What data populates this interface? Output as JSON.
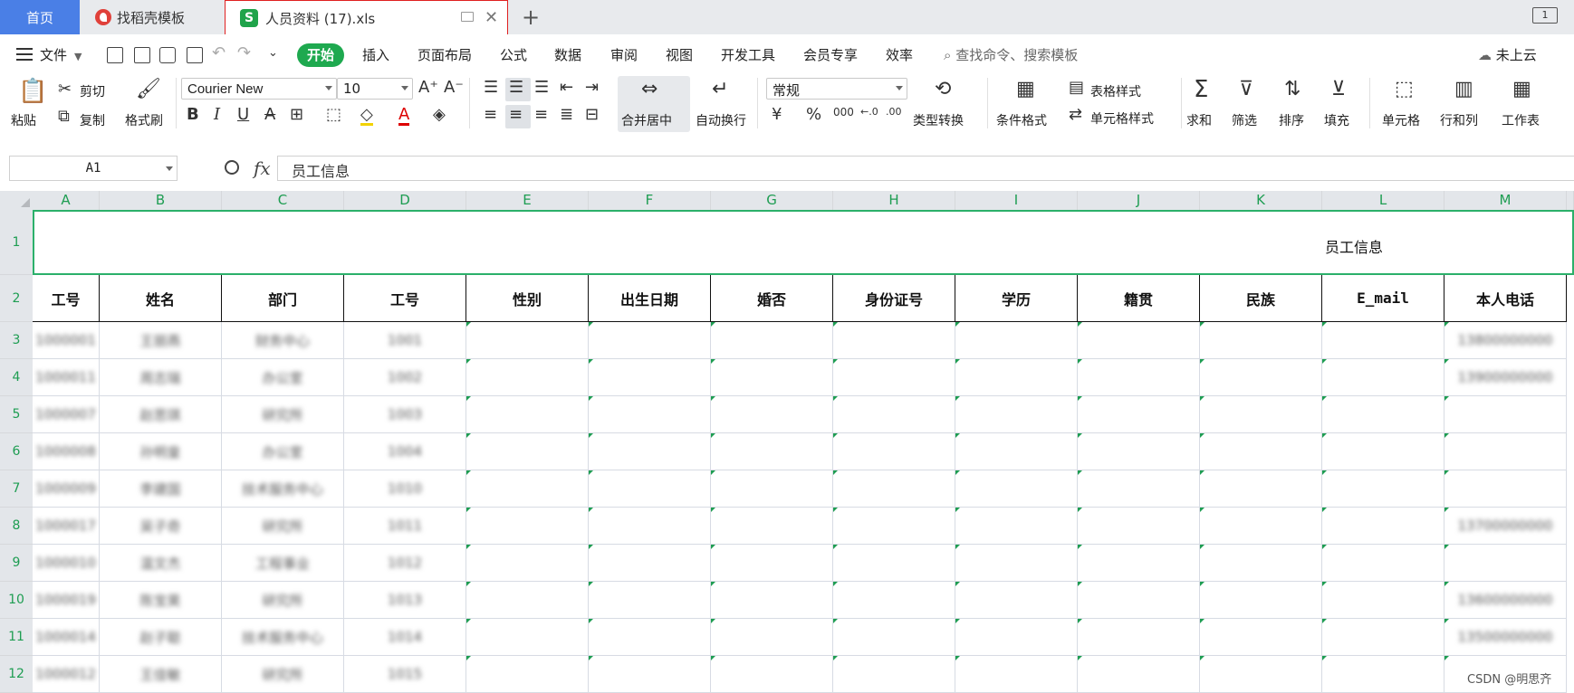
{
  "tabs": {
    "home": "首页",
    "template": "找稻壳模板",
    "file": "人员资料 (17).xls",
    "file_logo": "S",
    "add": "+",
    "win": "1"
  },
  "menu": {
    "file": "文件",
    "items": [
      "开始",
      "插入",
      "页面布局",
      "公式",
      "数据",
      "审阅",
      "视图",
      "开发工具",
      "会员专享",
      "效率"
    ],
    "search": "查找命令、搜索模板",
    "cloud": "未上云"
  },
  "ribbon": {
    "paste": "粘贴",
    "cut": "剪切",
    "copy": "复制",
    "format_painter": "格式刷",
    "font_name": "Courier New",
    "font_size": "10",
    "merge": "合并居中",
    "wrap": "自动换行",
    "number_format": "常规",
    "convert": "类型转换",
    "cond_format": "条件格式",
    "table_style": "表格样式",
    "cell_style": "单元格样式",
    "sum": "求和",
    "filter": "筛选",
    "sort": "排序",
    "fill": "填充",
    "cell": "单元格",
    "row_col": "行和列",
    "sheet": "工作表"
  },
  "formula_bar": {
    "name_box": "A1",
    "fx": "fx",
    "value": "员工信息"
  },
  "sheet": {
    "columns": [
      "A",
      "B",
      "C",
      "D",
      "E",
      "F",
      "G",
      "H",
      "I",
      "J",
      "K",
      "L",
      "M"
    ],
    "rows": [
      "1",
      "2",
      "3",
      "4",
      "5",
      "6",
      "7",
      "8",
      "9",
      "10",
      "11",
      "12"
    ],
    "title": "员工信息",
    "headers": [
      "工号",
      "姓名",
      "部门",
      "工号",
      "性别",
      "出生日期",
      "婚否",
      "身份证号",
      "学历",
      "籍贯",
      "民族",
      "E_mail",
      "本人电话"
    ],
    "data": [
      [
        "1000001",
        "王丽燕",
        "财务中心",
        "1001",
        "",
        "",
        "",
        "",
        "",
        "",
        "",
        "",
        "13800000000"
      ],
      [
        "1000011",
        "周志瑞",
        "办公室",
        "1002",
        "",
        "",
        "",
        "",
        "",
        "",
        "",
        "",
        "13900000000"
      ],
      [
        "1000007",
        "赵思琪",
        "研究所",
        "1003",
        "",
        "",
        "",
        "",
        "",
        "",
        "",
        "",
        ""
      ],
      [
        "1000008",
        "孙明皇",
        "办公室",
        "1004",
        "",
        "",
        "",
        "",
        "",
        "",
        "",
        "",
        ""
      ],
      [
        "1000009",
        "李建国",
        "技术服务中心",
        "1010",
        "",
        "",
        "",
        "",
        "",
        "",
        "",
        "",
        ""
      ],
      [
        "1000017",
        "吴子奇",
        "研究所",
        "1011",
        "",
        "",
        "",
        "",
        "",
        "",
        "",
        "",
        "13700000000"
      ],
      [
        "1000010",
        "温文杰",
        "工程事业",
        "1012",
        "",
        "",
        "",
        "",
        "",
        "",
        "",
        "",
        ""
      ],
      [
        "1000019",
        "陈宝昊",
        "研究所",
        "1013",
        "",
        "",
        "",
        "",
        "",
        "",
        "",
        "",
        "13600000000"
      ],
      [
        "1000014",
        "赵子聪",
        "技术服务中心",
        "1014",
        "",
        "",
        "",
        "",
        "",
        "",
        "",
        "",
        "13500000000"
      ],
      [
        "1000012",
        "王佳敏",
        "研究所",
        "1015",
        "",
        "",
        "",
        "",
        "",
        "",
        "",
        "",
        ""
      ]
    ]
  },
  "watermark": "CSDN @明思齐"
}
